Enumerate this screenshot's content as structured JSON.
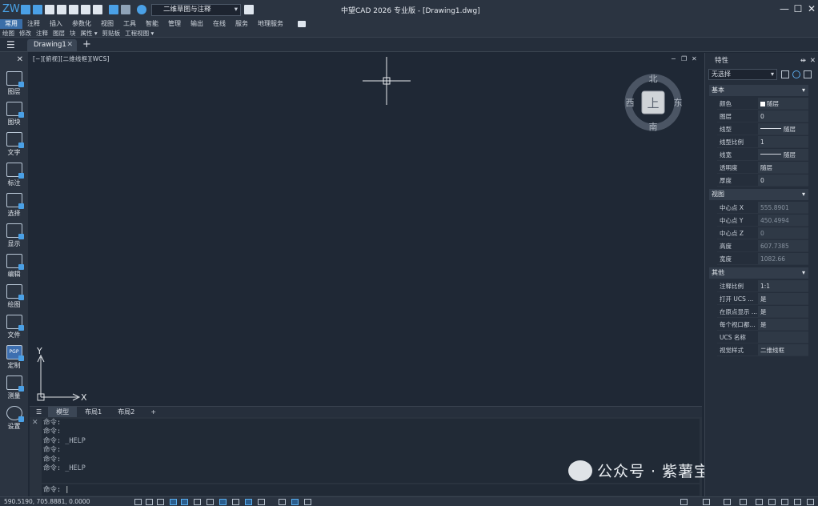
{
  "titlebar": {
    "logo": "ZW",
    "workspace": "二维草图与注释",
    "app_title": "中望CAD 2026 专业版 - [Drawing1.dwg]",
    "min": "—",
    "max": "☐",
    "close": "✕"
  },
  "ribbon": {
    "tabs": [
      "常用",
      "注释",
      "插入",
      "参数化",
      "视图",
      "工具",
      "智能",
      "管理",
      "输出",
      "在线",
      "服务",
      "地理服务"
    ],
    "subtabs": [
      "绘图",
      "修改",
      "注释",
      "图层",
      "块",
      "属性 ▾",
      "剪贴板",
      "工程视图 ▾"
    ]
  },
  "doc_tabs": {
    "menu": "☰",
    "active": "Drawing1",
    "close": "✕",
    "add": "+"
  },
  "left_toolbar": {
    "close": "✕",
    "tools": [
      "图层",
      "图块",
      "文字",
      "标注",
      "选择",
      "显示",
      "编辑",
      "绘图",
      "文件",
      "定制",
      "测量",
      "设置"
    ],
    "pgp_label": "PGP"
  },
  "canvas": {
    "view_label": "[−][俯视][二维线框][WCS]",
    "ctl_min": "−",
    "ctl_restore": "❐",
    "ctl_close": "✕",
    "viewcube": {
      "top": "上",
      "north": "北",
      "south": "南",
      "west": "西",
      "east": "东"
    },
    "ucs": {
      "x": "X",
      "y": "Y"
    }
  },
  "layout_tabs": {
    "menu": "☰",
    "tabs": [
      "模型",
      "布局1",
      "布局2"
    ],
    "active": "模型",
    "add": "+"
  },
  "command": {
    "history": [
      "命令:",
      "命令:",
      "命令: _HELP",
      "命令:",
      "命令:",
      "命令: _HELP"
    ],
    "prompt": "命令:"
  },
  "watermark": "公众号 · 紫薯宝宝",
  "statusbar": {
    "coords": "590.5190,  705.8881,  0.0000"
  },
  "properties": {
    "title": "特性",
    "pin": "⇹",
    "close": "✕",
    "selection": "无选择",
    "sections": [
      {
        "name": "基本",
        "rows": [
          {
            "key": "颜色",
            "value": "随层",
            "swatch": true
          },
          {
            "key": "图层",
            "value": "0"
          },
          {
            "key": "线型",
            "value": "随层",
            "line": true
          },
          {
            "key": "线型比例",
            "value": "1"
          },
          {
            "key": "线宽",
            "value": "随层",
            "line": true
          },
          {
            "key": "透明度",
            "value": "随层"
          },
          {
            "key": "厚度",
            "value": "0"
          }
        ]
      },
      {
        "name": "视图",
        "rows": [
          {
            "key": "中心点 X",
            "value": "555.8901",
            "dim": true
          },
          {
            "key": "中心点 Y",
            "value": "450.4994",
            "dim": true
          },
          {
            "key": "中心点 Z",
            "value": "0",
            "dim": true
          },
          {
            "key": "高度",
            "value": "607.7385",
            "dim": true
          },
          {
            "key": "宽度",
            "value": "1082.66",
            "dim": true
          }
        ]
      },
      {
        "name": "其他",
        "rows": [
          {
            "key": "注释比例",
            "value": "1:1"
          },
          {
            "key": "打开 UCS ...",
            "value": "是"
          },
          {
            "key": "在原点显示 ...",
            "value": "是"
          },
          {
            "key": "每个视口都...",
            "value": "是"
          },
          {
            "key": "UCS 名称",
            "value": ""
          },
          {
            "key": "视觉样式",
            "value": "二维线框"
          }
        ]
      }
    ]
  }
}
